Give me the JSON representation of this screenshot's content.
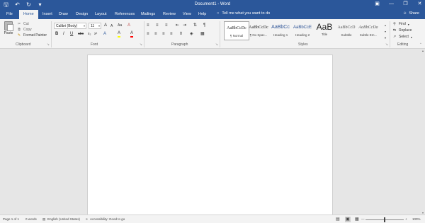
{
  "titlebar": {
    "title": "Document1 - Word",
    "qat_icons": [
      "save-icon",
      "undo-icon",
      "redo-icon",
      "customize-icon"
    ],
    "window_controls": [
      "ribbon-display-icon",
      "minimize-icon",
      "restore-icon",
      "close-icon"
    ]
  },
  "tabs": [
    "File",
    "Home",
    "Insert",
    "Draw",
    "Design",
    "Layout",
    "References",
    "Mailings",
    "Review",
    "View",
    "Help"
  ],
  "active_tab": "Home",
  "tell_me": "Tell me what you want to do",
  "share": "Share",
  "clipboard": {
    "label": "Clipboard",
    "paste": "Paste",
    "cut": "Cut",
    "copy": "Copy",
    "format_painter": "Format Painter"
  },
  "font": {
    "label": "Font",
    "name": "Calibri (Body)",
    "size": "11",
    "bold": "B",
    "italic": "I",
    "underline": "U",
    "grow": "A",
    "shrink": "A",
    "case": "Aa",
    "clear": "A",
    "highlight": "A"
  },
  "paragraph": {
    "label": "Paragraph",
    "show_marks": "¶"
  },
  "styles": {
    "label": "Styles",
    "items": [
      {
        "sample": "AaBbCcDc",
        "name": "¶ Normal"
      },
      {
        "sample": "AaBbCcDc",
        "name": "¶ No Spac..."
      },
      {
        "sample": "AaBbCc",
        "name": "Heading 1"
      },
      {
        "sample": "AaBbCcE",
        "name": "Heading 2"
      },
      {
        "sample": "AaB",
        "name": "Title"
      },
      {
        "sample": "AaBbCcD",
        "name": "Subtitle"
      },
      {
        "sample": "AaBbCcDa",
        "name": "Subtle Em..."
      }
    ]
  },
  "editing": {
    "label": "Editing",
    "find": "Find",
    "replace": "Replace",
    "select": "Select"
  },
  "status": {
    "page": "Page 1 of 1",
    "words": "0 words",
    "language": "English (United States)",
    "accessibility": "Accessibility: Good to go",
    "zoom": "100%",
    "zoom_level": 0.5
  },
  "colors": {
    "brand": "#2b579a",
    "highlight": "#ffff00",
    "font_color": "#ff0000"
  }
}
